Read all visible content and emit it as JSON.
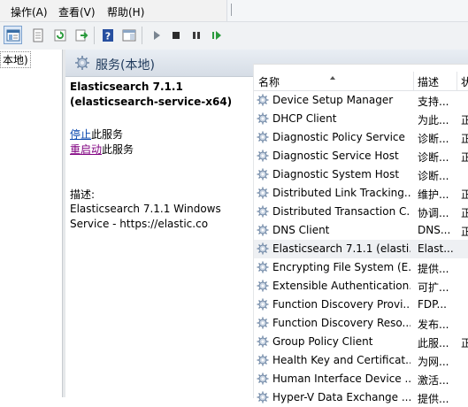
{
  "menu": {
    "items": [
      "操作(A)",
      "查看(V)",
      "帮助(H)"
    ]
  },
  "toolbar": {
    "buttons": [
      "console-tree-icon",
      "properties-icon",
      "refresh-icon",
      "export-icon",
      "help-icon",
      "show-pane-icon",
      "start-icon",
      "stop-icon",
      "pause-icon",
      "restart-icon"
    ],
    "colors": {
      "play": "#2f6ea8",
      "stop": "#2c2c2c",
      "resume": "#2a9a3c"
    }
  },
  "tree": {
    "node_label": "本地)"
  },
  "header": {
    "title": "服务(本地)"
  },
  "detail": {
    "service_title": "Elasticsearch 7.1.1 (elasticsearch-service-x64)",
    "stop_link": "停止",
    "stop_suffix": "此服务",
    "restart_link": "重启动",
    "restart_suffix": "此服务",
    "description_label": "描述:",
    "description_text": "Elasticsearch 7.1.1 Windows Service - https://elastic.co"
  },
  "columns": {
    "name": "名称",
    "description": "描述",
    "status": "状"
  },
  "services": [
    {
      "name": "Device Setup Manager",
      "description": "支持...",
      "status": ""
    },
    {
      "name": "DHCP Client",
      "description": "为此...",
      "status": "正"
    },
    {
      "name": "Diagnostic Policy Service",
      "description": "诊断...",
      "status": "正"
    },
    {
      "name": "Diagnostic Service Host",
      "description": "诊断...",
      "status": "正"
    },
    {
      "name": "Diagnostic System Host",
      "description": "诊断...",
      "status": ""
    },
    {
      "name": "Distributed Link Tracking...",
      "description": "维护...",
      "status": "正"
    },
    {
      "name": "Distributed Transaction C...",
      "description": "协调...",
      "status": "正"
    },
    {
      "name": "DNS Client",
      "description": "DNS...",
      "status": "正"
    },
    {
      "name": "Elasticsearch 7.1.1 (elasti...",
      "description": "Elast...",
      "status": ""
    },
    {
      "name": "Encrypting File System (E...",
      "description": "提供...",
      "status": ""
    },
    {
      "name": "Extensible Authentication...",
      "description": "可扩...",
      "status": ""
    },
    {
      "name": "Function Discovery Provi...",
      "description": "FDP...",
      "status": ""
    },
    {
      "name": "Function Discovery Reso...",
      "description": "发布...",
      "status": ""
    },
    {
      "name": "Group Policy Client",
      "description": "此服...",
      "status": "正"
    },
    {
      "name": "Health Key and Certificat...",
      "description": "为网...",
      "status": ""
    },
    {
      "name": "Human Interface Device ...",
      "description": "激活...",
      "status": ""
    },
    {
      "name": "Hyper-V Data Exchange ...",
      "description": "提供...",
      "status": ""
    }
  ],
  "selected_row": 8
}
